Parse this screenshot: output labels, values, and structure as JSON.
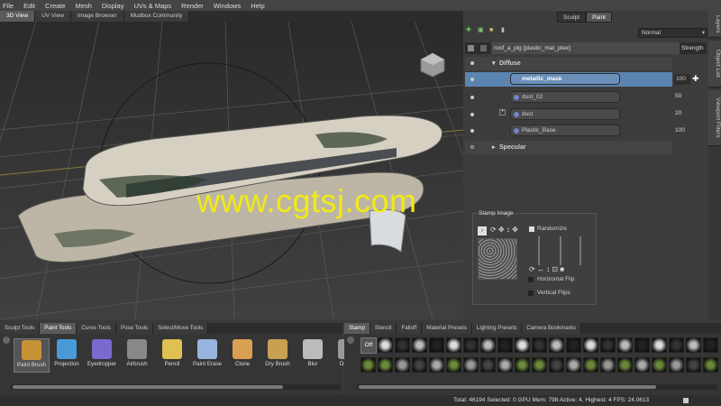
{
  "menu": [
    "File",
    "Edit",
    "Create",
    "Mesh",
    "Display",
    "UVs & Maps",
    "Render",
    "Windows",
    "Help"
  ],
  "viewport_tabs": [
    "3D View",
    "UV View",
    "Image Browser",
    "Mudbox Community"
  ],
  "viewport": {
    "watermark": "www.cgtsj.com"
  },
  "right": {
    "switch": [
      "Sculpt",
      "Paint"
    ],
    "blend_mode": "Normal",
    "layer_title": "roof_a_plg [plastic_mat_ptex]",
    "strength_label": "Strength",
    "groups": [
      {
        "label": "Diffuse"
      },
      {
        "label": "Specular"
      }
    ],
    "layers": [
      {
        "label": "metallic_mask",
        "value": "100"
      },
      {
        "label": "dust_02",
        "value": "50"
      },
      {
        "label": "dust",
        "value": "20"
      },
      {
        "label": "Plastic_Base",
        "value": "100"
      }
    ],
    "side_tabs": [
      "Layers",
      "Object List",
      "Viewport Filters"
    ]
  },
  "stamp_panel": {
    "title": "Stamp Image",
    "randomize": "Randomize",
    "hflip": "Horizontal Flip",
    "vflip": "Vertical Flips"
  },
  "tool_tabs": [
    "Sculpt Tools",
    "Paint Tools",
    "Curve Tools",
    "Pose Tools",
    "Select/Move Tools"
  ],
  "tools": [
    {
      "label": "Paint Brush",
      "color": "#c89238"
    },
    {
      "label": "Projection",
      "color": "#4a9ad8"
    },
    {
      "label": "Eyedropper",
      "color": "#7a6ad0"
    },
    {
      "label": "Airbrush",
      "color": "#888"
    },
    {
      "label": "Pencil",
      "color": "#e0c050"
    },
    {
      "label": "Paint Erase",
      "color": "#9ab4e0"
    },
    {
      "label": "Clone",
      "color": "#d8a050"
    },
    {
      "label": "Dry Brush",
      "color": "#c8a050"
    },
    {
      "label": "Blur",
      "color": "#bbb"
    },
    {
      "label": "Dodge",
      "color": "#999"
    }
  ],
  "stamp_tabs": [
    "Stamp",
    "Stencil",
    "Falloff",
    "Material Presets",
    "Lighting Presets",
    "Camera Bookmarks"
  ],
  "stamp_off": "Off",
  "status": "Total: 46194  Selected: 0 GPU Mem: 798  Active: 4, Highest: 4  FPS: 24.0613"
}
